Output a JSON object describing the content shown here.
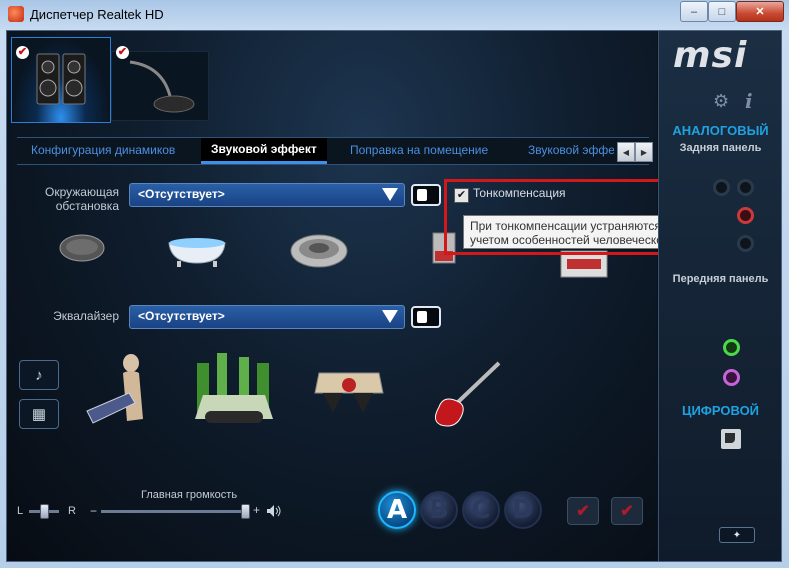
{
  "window": {
    "title": "Диспетчер Realtek HD",
    "minimize": "–",
    "maximize": "□",
    "close": "✕"
  },
  "tabs": {
    "items": [
      {
        "label": "Конфигурация динамиков"
      },
      {
        "label": "Звуковой эффект"
      },
      {
        "label": "Поправка на помещение"
      },
      {
        "label": "Звуковой эффе"
      }
    ],
    "active_index": 1,
    "scroll_left": "◀",
    "scroll_right": "▶"
  },
  "environment": {
    "label_line1": "Окружающая",
    "label_line2": "обстановка",
    "value": "<Отсутствует>"
  },
  "equalizer": {
    "label": "Эквалайзер",
    "value": "<Отсутствует>"
  },
  "loudness": {
    "label": "Тонкомпенсация",
    "checked": true,
    "check_glyph": "✔",
    "tooltip_line1": "При тонкомпенсации устраняются различия громкости с",
    "tooltip_line2": "учетом особенностей человеческого восприятия."
  },
  "volume": {
    "label": "Главная громкость",
    "balance_left": "L",
    "balance_right": "R",
    "minus": "−",
    "plus": "+",
    "level": 0.95,
    "balance": 0.5
  },
  "profiles": {
    "items": [
      "A",
      "B",
      "C",
      "D"
    ],
    "active_index": 0
  },
  "right_panel": {
    "brand": "msi",
    "analog_title": "АНАЛОГОВЫЙ",
    "rear_panel": "Задняя панель",
    "front_panel": "Передняя панель",
    "digital_title": "ЦИФРОВОЙ",
    "gear_glyph": "⚙",
    "info_glyph": "i",
    "wrench_glyph": "🔧"
  },
  "colors": {
    "accent_blue": "#3f8fe8",
    "analog_title": "#1fa2e0",
    "red_highlight": "#d21818",
    "green_jack": "#4bd84b",
    "pink_jack": "#c566d6"
  }
}
